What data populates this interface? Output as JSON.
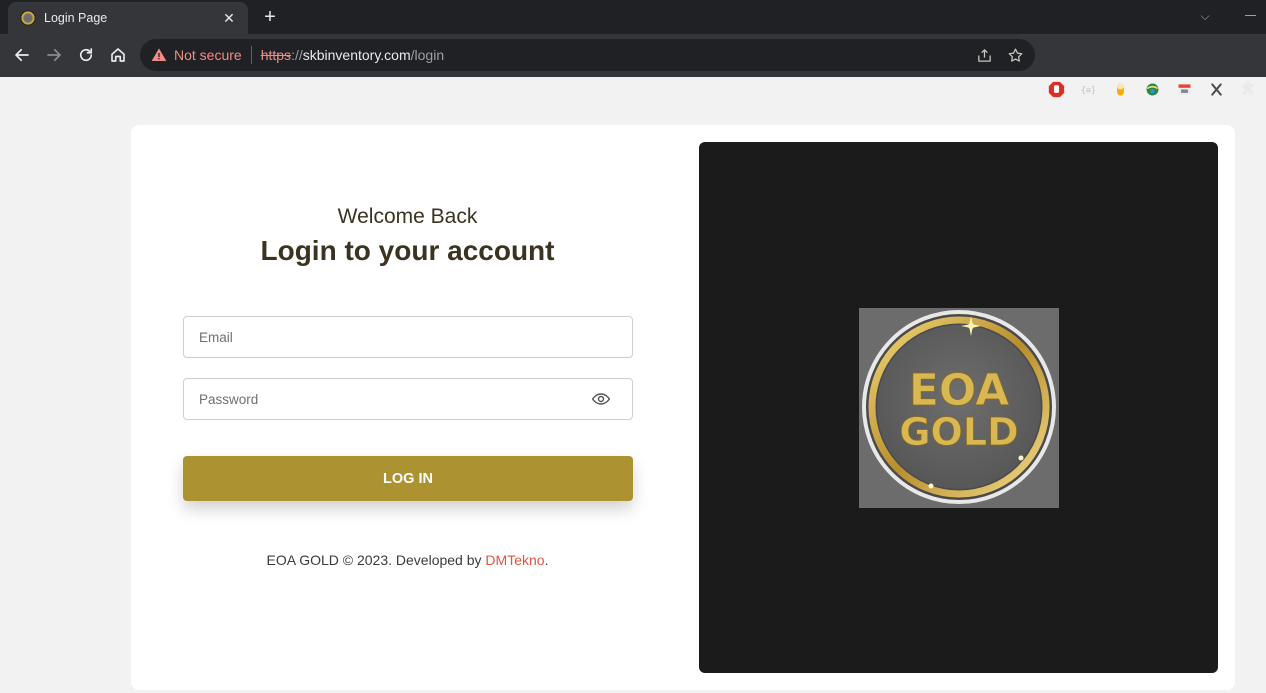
{
  "browser": {
    "tab_title": "Login Page",
    "tab_close": "✕",
    "new_tab": "+",
    "tab_search": "⌵",
    "security_label": "Not secure",
    "url_scheme": "https",
    "url_sep": "://",
    "url_host": "skbinventory.com",
    "url_path": "/login",
    "colors": {
      "chrome_dark": "#202124",
      "chrome_toolbar": "#35363a",
      "warning": "#f28b82"
    }
  },
  "login": {
    "welcome": "Welcome Back",
    "heading": "Login to your account",
    "email_placeholder": "Email",
    "password_placeholder": "Password",
    "submit_label": "LOG IN"
  },
  "footer": {
    "text": "EOA GOLD © 2023. Developed by ",
    "link": "DMTekno",
    "end": "."
  },
  "brand": {
    "line1": "EOA",
    "line2": "GOLD",
    "colors": {
      "gold": "#ad9231",
      "panel": "#1b1b1b",
      "link": "#e5533d"
    }
  }
}
